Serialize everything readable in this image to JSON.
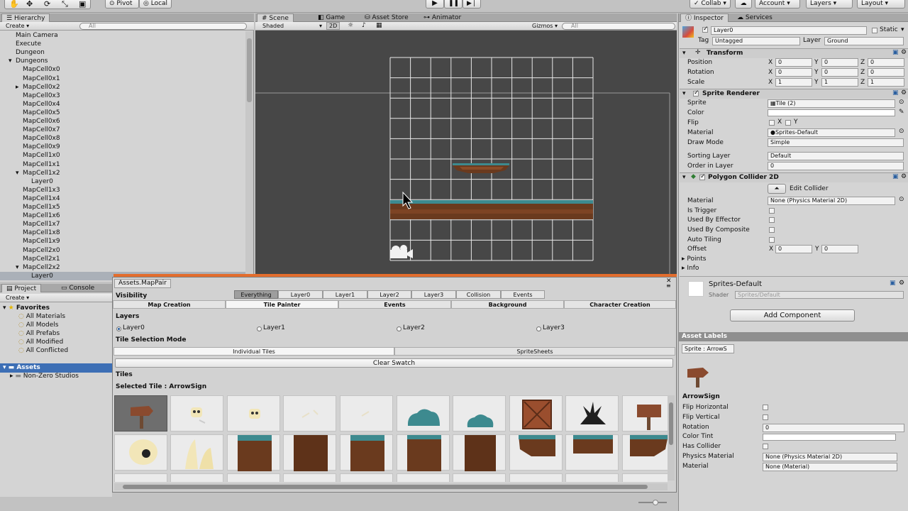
{
  "toolbar": {
    "pivot": "Pivot",
    "local": "Local",
    "collab": "Collab",
    "account": "Account",
    "layers": "Layers",
    "layout": "Layout"
  },
  "hierarchy": {
    "tab": "Hierarchy",
    "create": "Create",
    "search_placeholder": "All",
    "items": [
      "Main Camera",
      "Execute",
      "Dungeon",
      "Dungeons",
      "MapCell0x0",
      "MapCell0x1",
      "MapCell0x2",
      "MapCell0x3",
      "MapCell0x4",
      "MapCell0x5",
      "MapCell0x6",
      "MapCell0x7",
      "MapCell0x8",
      "MapCell0x9",
      "MapCell1x0",
      "MapCell1x1",
      "MapCell1x2",
      "Layer0",
      "MapCell1x3",
      "MapCell1x4",
      "MapCell1x5",
      "MapCell1x6",
      "MapCell1x7",
      "MapCell1x8",
      "MapCell1x9",
      "MapCell2x0",
      "MapCell2x1",
      "MapCell2x2",
      "Layer0"
    ]
  },
  "scene": {
    "tabs": [
      "Scene",
      "Game",
      "Asset Store",
      "Animator"
    ],
    "shaded": "Shaded",
    "mode2d": "2D",
    "gizmos": "Gizmos",
    "search": "All"
  },
  "project": {
    "tabs": [
      "Project",
      "Console"
    ],
    "create": "Create",
    "favorites": "Favorites",
    "fav_items": [
      "All Materials",
      "All Models",
      "All Prefabs",
      "All Modified",
      "All Conflicted"
    ],
    "assets": "Assets",
    "asset_items": [
      "Non-Zero Studios"
    ]
  },
  "mappair": {
    "title": "Assets.MapPair",
    "visibility_label": "Visibility",
    "visibility_tabs": [
      "Everything",
      "Layer0",
      "Layer1",
      "Layer2",
      "Layer3",
      "Collision",
      "Events"
    ],
    "mode_tabs": [
      "Map Creation",
      "Tile Painter",
      "Events",
      "Background",
      "Character Creation"
    ],
    "layers_label": "Layers",
    "layers": [
      "Layer0",
      "Layer1",
      "Layer2",
      "Layer3"
    ],
    "tile_mode_label": "Tile Selection Mode",
    "tile_modes": [
      "Individual Tiles",
      "SpriteSheets"
    ],
    "clear_swatch": "Clear Swatch",
    "tiles_label": "Tiles",
    "selected_tile": "Selected Tile : ArrowSign"
  },
  "inspector": {
    "tabs": [
      "Inspector",
      "Services"
    ],
    "object_name": "Layer0",
    "static": "Static",
    "tag_label": "Tag",
    "tag_value": "Untagged",
    "layer_label": "Layer",
    "layer_value": "Ground",
    "transform": {
      "title": "Transform",
      "rows": [
        {
          "label": "Position",
          "x": "0",
          "y": "0",
          "z": "0"
        },
        {
          "label": "Rotation",
          "x": "0",
          "y": "0",
          "z": "0"
        },
        {
          "label": "Scale",
          "x": "1",
          "y": "1",
          "z": "1"
        }
      ]
    },
    "sprite_renderer": {
      "title": "Sprite Renderer",
      "sprite_label": "Sprite",
      "sprite_value": "Tile (2)",
      "color_label": "Color",
      "flip_label": "Flip",
      "flip_x": "X",
      "flip_y": "Y",
      "material_label": "Material",
      "material_value": "Sprites-Default",
      "draw_mode_label": "Draw Mode",
      "draw_mode_value": "Simple",
      "sorting_layer_label": "Sorting Layer",
      "sorting_layer_value": "Default",
      "order_label": "Order in Layer",
      "order_value": "0"
    },
    "polygon_collider": {
      "title": "Polygon Collider 2D",
      "edit_collider": "Edit Collider",
      "material_label": "Material",
      "material_value": "None (Physics Material 2D)",
      "is_trigger": "Is Trigger",
      "used_by_effector": "Used By Effector",
      "used_by_composite": "Used By Composite",
      "auto_tiling": "Auto Tiling",
      "offset_label": "Offset",
      "offset_x": "0",
      "offset_y": "0",
      "points": "Points",
      "info": "Info"
    },
    "material_block": {
      "name": "Sprites-Default",
      "shader_label": "Shader",
      "shader_value": "Sprites/Default"
    },
    "add_component": "Add Component"
  },
  "asset_labels": {
    "title": "Asset Labels",
    "sprite_field": "Sprite : ArrowS",
    "asset_name": "ArrowSign",
    "rows": [
      {
        "label": "Flip Horizontal",
        "type": "check"
      },
      {
        "label": "Flip Vertical",
        "type": "check"
      },
      {
        "label": "Rotation",
        "type": "value",
        "value": "0"
      },
      {
        "label": "Color Tint",
        "type": "color"
      },
      {
        "label": "Has Collider",
        "type": "check"
      },
      {
        "label": "Physics Material",
        "type": "value",
        "value": "None (Physics Material 2D)"
      },
      {
        "label": "Material",
        "type": "value",
        "value": "None (Material)"
      }
    ]
  }
}
